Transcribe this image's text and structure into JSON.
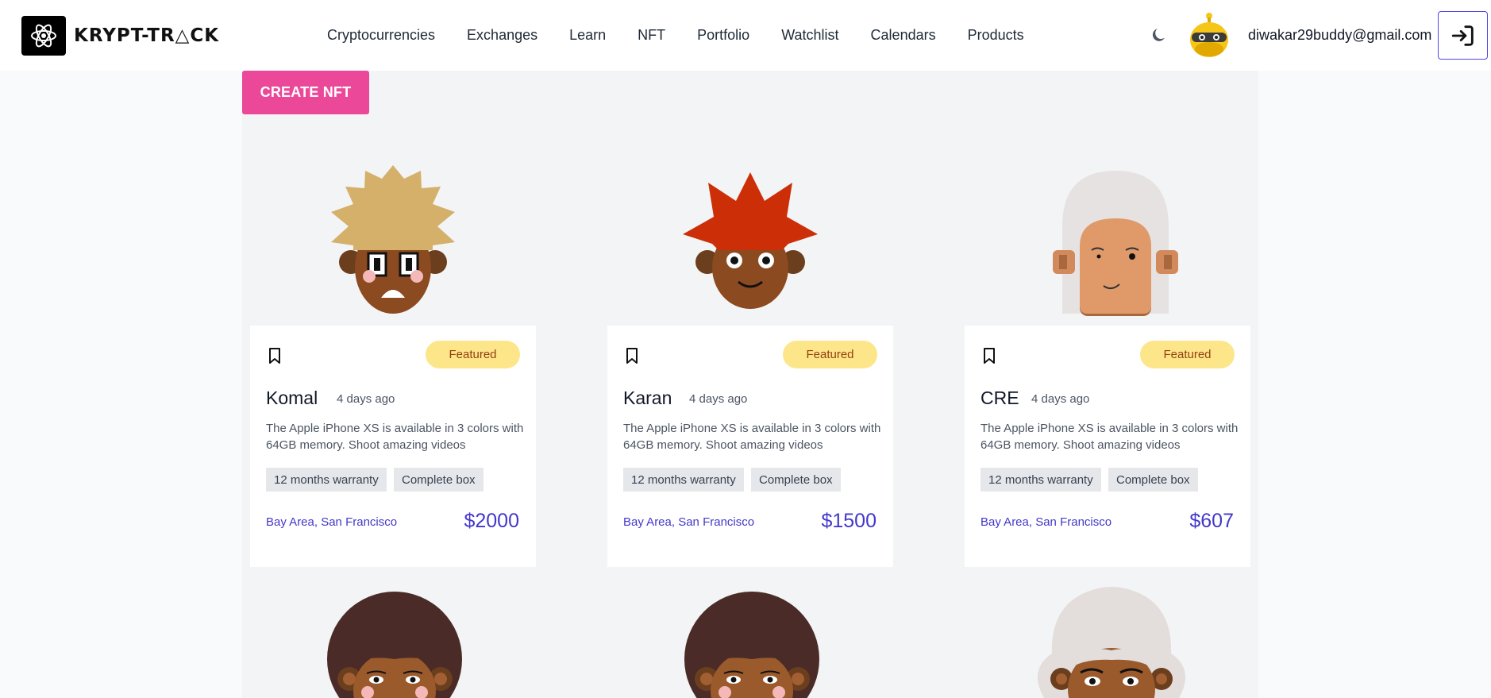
{
  "brand": {
    "name": "KRYPT-TR△CK"
  },
  "nav": {
    "items": [
      {
        "label": "Cryptocurrencies"
      },
      {
        "label": "Exchanges"
      },
      {
        "label": "Learn"
      },
      {
        "label": "NFT"
      },
      {
        "label": "Portfolio"
      },
      {
        "label": "Watchlist"
      },
      {
        "label": "Calendars"
      },
      {
        "label": "Products"
      }
    ]
  },
  "user": {
    "email": "diwakar29buddy@gmail.com"
  },
  "actions": {
    "create_label": "CREATE NFT"
  },
  "icons": {
    "theme": "moon-icon",
    "login": "login-arrow-icon",
    "bookmark": "bookmark-icon"
  },
  "colors": {
    "accent": "#4338ca",
    "pink": "#ec4899",
    "badge": "#fde68a"
  },
  "cards": [
    {
      "name": "Komal",
      "date": "4 days ago",
      "badge": "Featured",
      "description": "The Apple iPhone XS is available in 3 colors with 64GB memory. Shoot amazing videos",
      "tags": [
        "12 months warranty",
        "Complete box"
      ],
      "location": "Bay Area, San Francisco",
      "price": "$2000"
    },
    {
      "name": "Karan",
      "date": "4 days ago",
      "badge": "Featured",
      "description": "The Apple iPhone XS is available in 3 colors with 64GB memory. Shoot amazing videos",
      "tags": [
        "12 months warranty",
        "Complete box"
      ],
      "location": "Bay Area, San Francisco",
      "price": "$1500"
    },
    {
      "name": "CRE",
      "date": "4 days ago",
      "badge": "Featured",
      "description": "The Apple iPhone XS is available in 3 colors with 64GB memory. Shoot amazing videos",
      "tags": [
        "12 months warranty",
        "Complete box"
      ],
      "location": "Bay Area, San Francisco",
      "price": "$607"
    }
  ]
}
